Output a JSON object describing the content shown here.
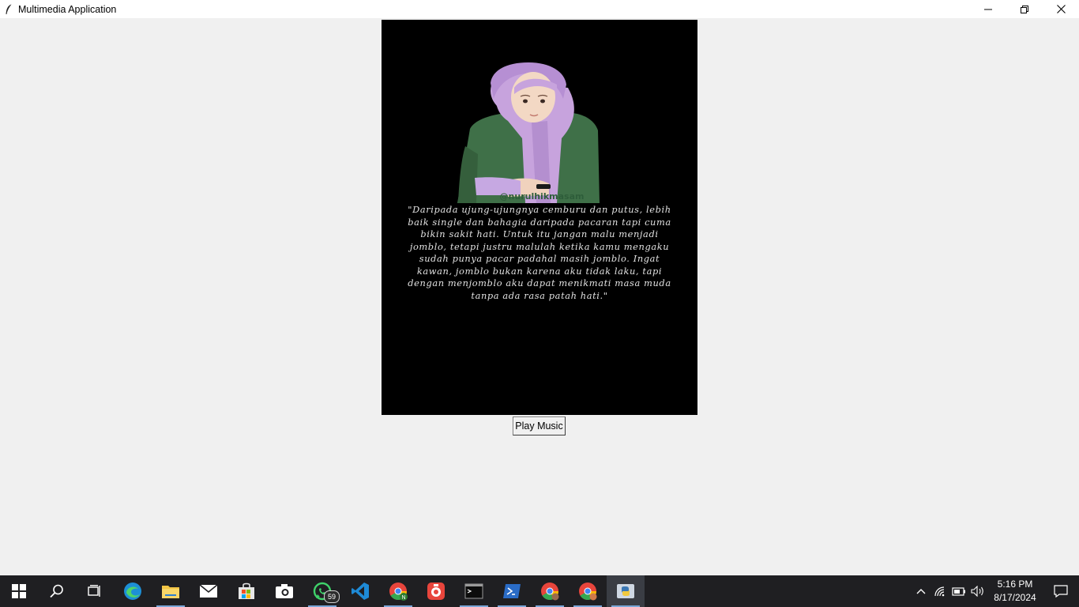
{
  "window": {
    "title": "Multimedia Application",
    "controls": [
      "minimize-icon",
      "restore-icon",
      "close-icon"
    ]
  },
  "media": {
    "watermark": "@nurulhikmasam",
    "quote": "\"Daripada ujung-ujungnya cemburu dan putus, lebih baik single dan bahagia daripada pacaran tapi cuma bikin sakit hati. Untuk itu jangan malu menjadi jomblo, tetapi justru malulah ketika kamu mengaku sudah punya pacar padahal masih jomblo. Ingat kawan, jomblo bukan karena aku tidak laku, tapi dengan menjomblo aku dapat menikmati masa muda tanpa ada rasa patah hati.\""
  },
  "play_button": {
    "label": "Play Music"
  },
  "taskbar": {
    "apps": [
      {
        "icon": "windows-start-icon"
      },
      {
        "icon": "search-icon"
      },
      {
        "icon": "task-view-icon"
      },
      {
        "icon": "edge-icon"
      },
      {
        "icon": "file-explorer-icon",
        "running": true
      },
      {
        "icon": "mail-icon"
      },
      {
        "icon": "microsoft-store-icon"
      },
      {
        "icon": "camera-icon"
      },
      {
        "icon": "whatsapp-icon",
        "running": true,
        "badge": "59"
      },
      {
        "icon": "vscode-icon"
      },
      {
        "icon": "chrome-profile-icon",
        "running": true
      },
      {
        "icon": "recorder-icon"
      },
      {
        "icon": "terminal-icon",
        "running": true
      },
      {
        "icon": "powershell-icon",
        "running": true
      },
      {
        "icon": "chrome-icon",
        "running": true
      },
      {
        "icon": "chrome-user-icon",
        "running": true
      },
      {
        "icon": "python-icon",
        "running": true,
        "active": true
      }
    ],
    "tray": [
      "chevron-up-icon",
      "wifi-icon",
      "battery-icon",
      "volume-icon"
    ],
    "clock": {
      "time": "5:16 PM",
      "date": "8/17/2024"
    },
    "notification_icon": "notification-icon"
  },
  "colors": {
    "titlebar": "#ffffff",
    "client_bg": "#f0f0f0",
    "taskbar": "#1f1f22",
    "hijab": "#c7a3dd",
    "jacket": "#3f7048"
  }
}
